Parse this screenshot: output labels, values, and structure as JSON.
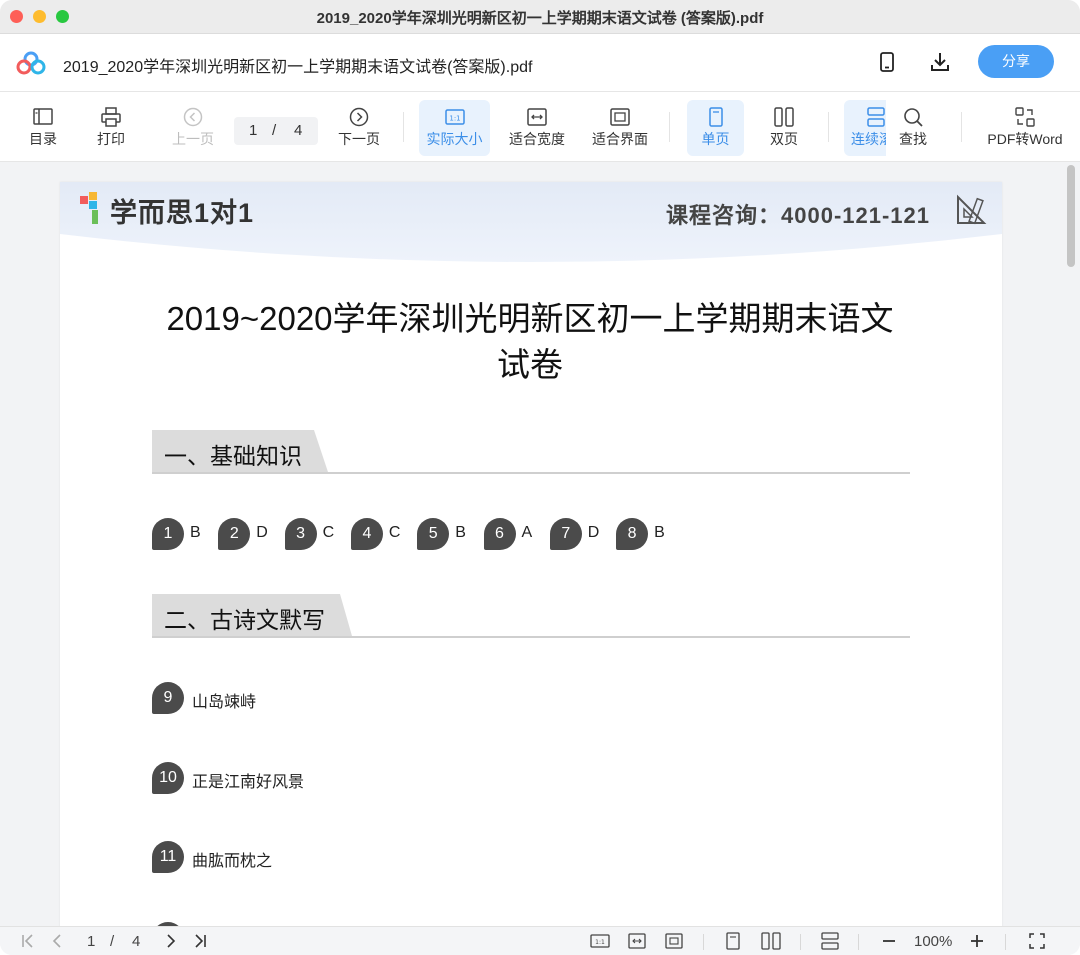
{
  "window": {
    "title": "2019_2020学年深圳光明新区初一上学期期末语文试卷 (答案版).pdf"
  },
  "header": {
    "file_title": "2019_2020学年深圳光明新区初一上学期期末语文试卷(答案版).pdf",
    "share_label": "分享",
    "icons": [
      "cloud-logo-icon",
      "phone-icon",
      "download-icon"
    ]
  },
  "toolbar": {
    "toc": "目录",
    "print": "打印",
    "prev": "上一页",
    "current_page": "1",
    "separator": "/",
    "total_pages": "4",
    "next": "下一页",
    "actual_size": "实际大小",
    "fit_width": "适合宽度",
    "fit_page": "适合界面",
    "single_page": "单页",
    "two_page": "双页",
    "continuous": "连续滚",
    "search": "查找",
    "pdf_to_word": "PDF转Word"
  },
  "document": {
    "brand": "学而思1对1",
    "hotline": "课程咨询：4000-121-121",
    "title_line1": "2019~2020学年深圳光明新区初一上学期期末语文",
    "title_line2": "试卷",
    "section1": "一、基础知识",
    "section2": "二、古诗文默写",
    "choice_answers": [
      {
        "num": "1",
        "ans": "B"
      },
      {
        "num": "2",
        "ans": "D"
      },
      {
        "num": "3",
        "ans": "C"
      },
      {
        "num": "4",
        "ans": "C"
      },
      {
        "num": "5",
        "ans": "B"
      },
      {
        "num": "6",
        "ans": "A"
      },
      {
        "num": "7",
        "ans": "D"
      },
      {
        "num": "8",
        "ans": "B"
      }
    ],
    "poem_answers": [
      {
        "num": "9",
        "ans": "山岛竦峙"
      },
      {
        "num": "10",
        "ans": "正是江南好风景"
      },
      {
        "num": "11",
        "ans": "曲肱而枕之"
      }
    ]
  },
  "bottombar": {
    "current_page": "1",
    "separator": "/",
    "total_pages": "4",
    "zoom": "100%"
  },
  "colors": {
    "accent": "#4a9ff5",
    "active_bg": "#e8f2fd",
    "badge": "#4b4b4b",
    "section_tab": "#dcdcdc"
  }
}
